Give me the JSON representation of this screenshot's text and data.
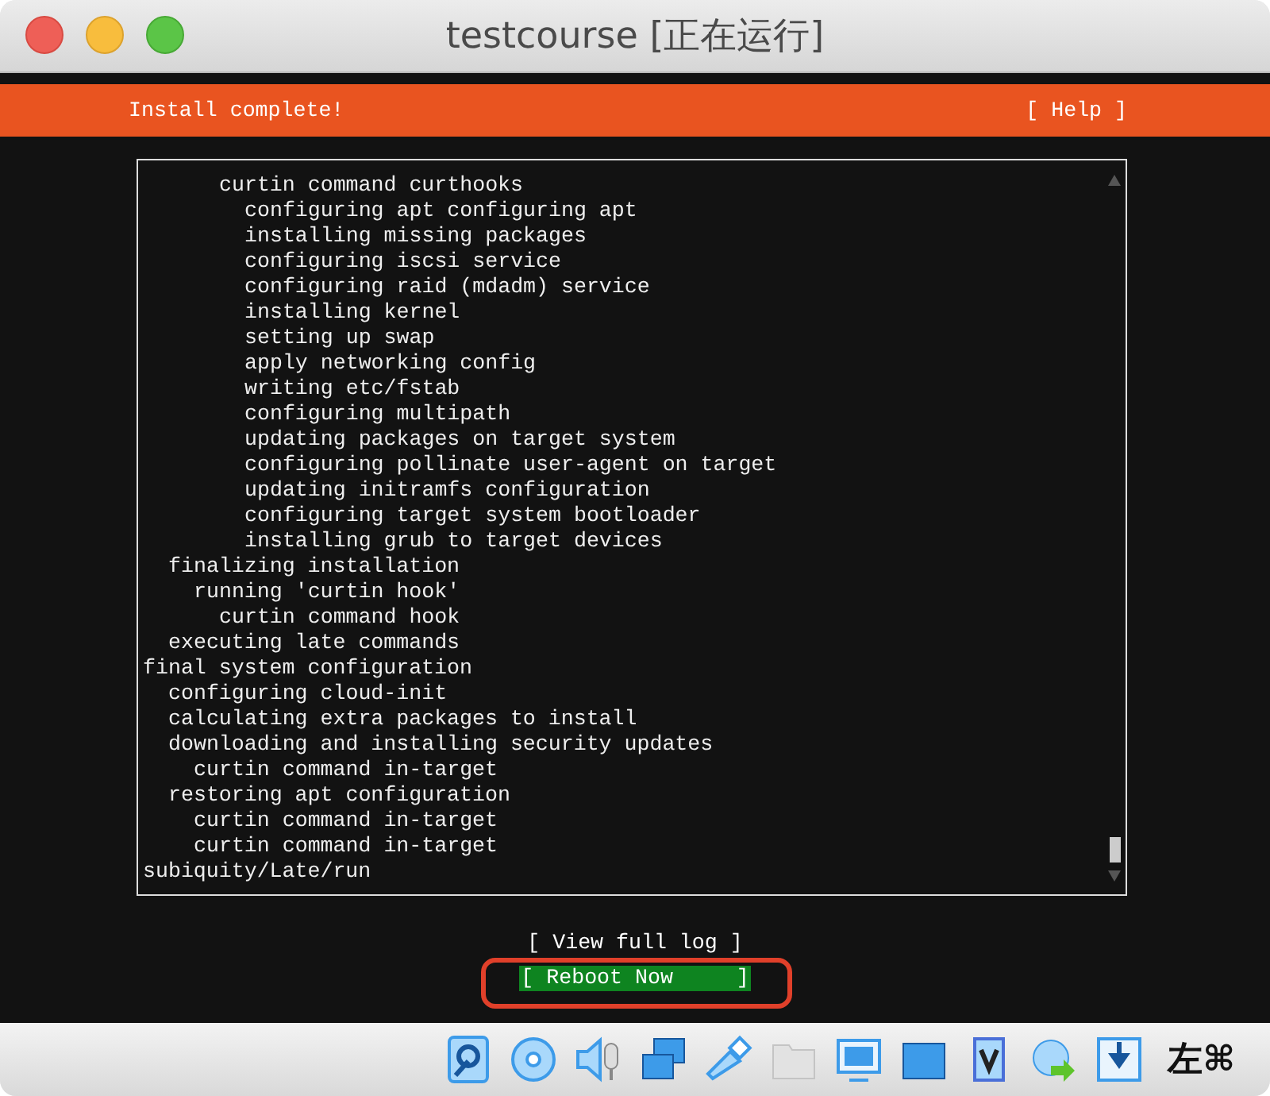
{
  "window": {
    "title": "testcourse [正在运行]"
  },
  "header": {
    "title": "Install complete!",
    "help": "[ Help ]"
  },
  "log": {
    "lines": [
      {
        "children": [
          {
            "children": [
              {
                "children": [
                  {
                    "text": "curtin command curthooks",
                    "children": [
                      {
                        "text": "configuring apt configuring apt"
                      },
                      {
                        "text": "installing missing packages"
                      },
                      {
                        "text": "configuring iscsi service"
                      },
                      {
                        "text": "configuring raid (mdadm) service"
                      },
                      {
                        "text": "installing kernel"
                      },
                      {
                        "text": "setting up swap"
                      },
                      {
                        "text": "apply networking config"
                      },
                      {
                        "text": "writing etc/fstab"
                      },
                      {
                        "text": "configuring multipath"
                      },
                      {
                        "text": "updating packages on target system"
                      },
                      {
                        "text": "configuring pollinate user-agent on target"
                      },
                      {
                        "text": "updating initramfs configuration"
                      },
                      {
                        "text": "configuring target system bootloader"
                      },
                      {
                        "text": "installing grub to target devices"
                      }
                    ]
                  }
                ]
              }
            ]
          },
          {
            "text": "finalizing installation",
            "children": [
              {
                "text": "running 'curtin hook'",
                "children": [
                  {
                    "text": "curtin command hook"
                  }
                ]
              }
            ]
          },
          {
            "text": "executing late commands"
          }
        ]
      },
      {
        "text": "final system configuration",
        "children": [
          {
            "text": "configuring cloud-init"
          },
          {
            "text": "calculating extra packages to install"
          },
          {
            "text": "downloading and installing security updates",
            "children": [
              {
                "text": "curtin command in-target"
              }
            ]
          },
          {
            "text": "restoring apt configuration",
            "children": [
              {
                "text": "curtin command in-target"
              },
              {
                "text": "curtin command in-target"
              }
            ]
          }
        ]
      },
      {
        "text": "subiquity/Late/run"
      }
    ]
  },
  "buttons": [
    {
      "label": "[ View full log ]",
      "selected": false
    },
    {
      "label": "[ Reboot Now     ]",
      "selected": true,
      "highlighted": true
    }
  ],
  "status_bar": {
    "host_key": "左⌘"
  }
}
